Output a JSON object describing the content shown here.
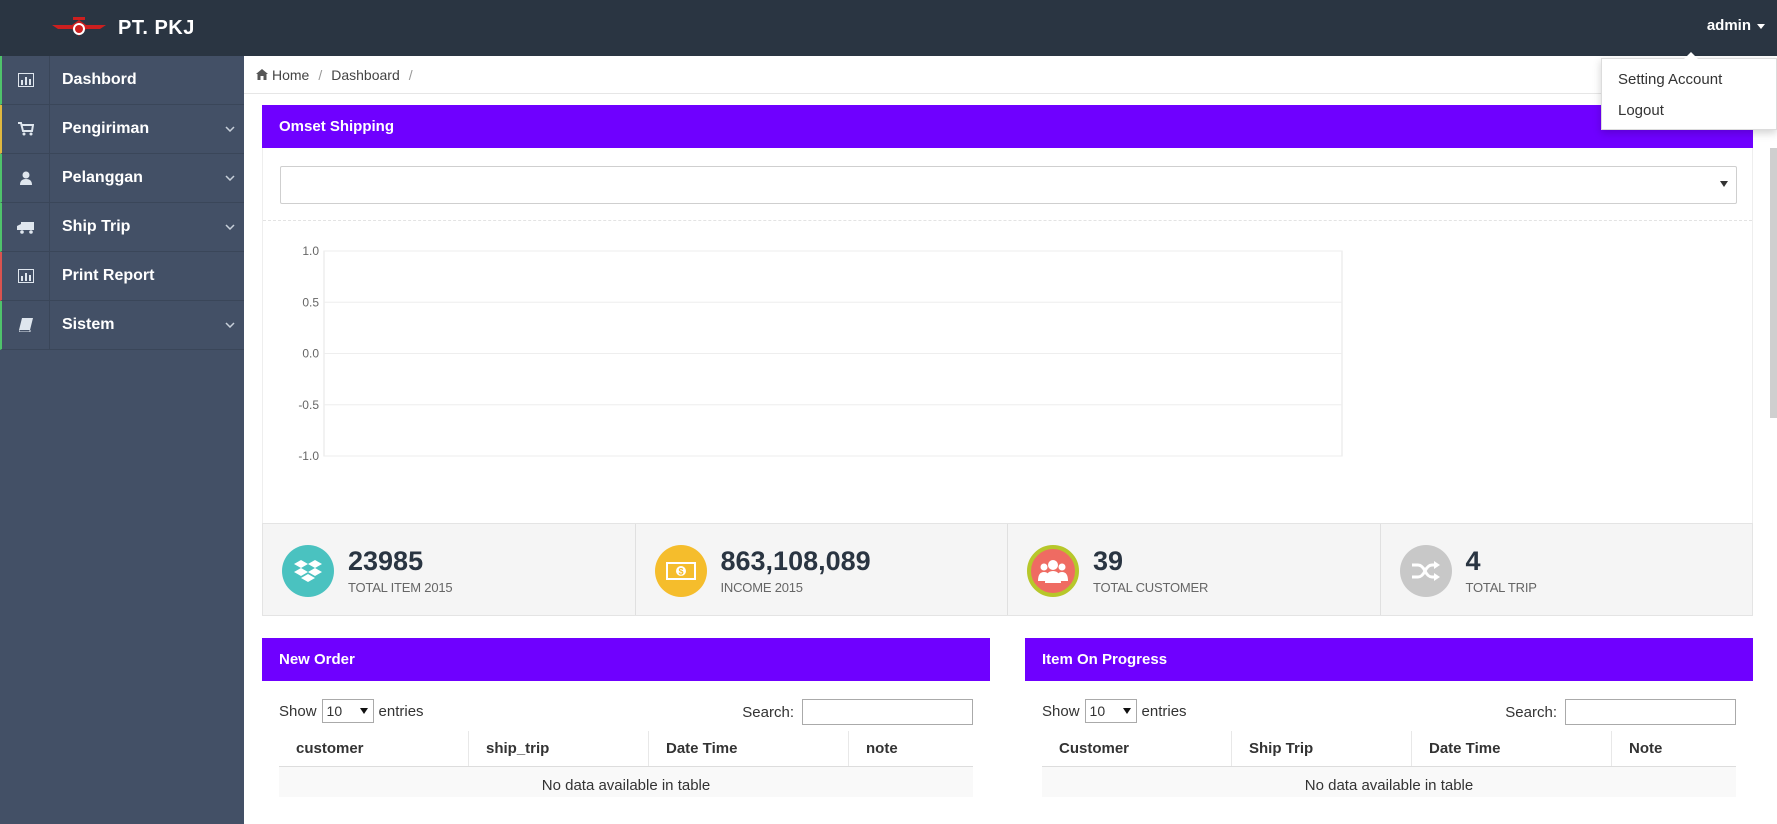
{
  "topbar": {
    "brand": "PT. PKJ",
    "user": "admin"
  },
  "user_dropdown": {
    "items": [
      "Setting Account",
      "Logout"
    ]
  },
  "sidebar": {
    "items": [
      {
        "label": "Dashbord",
        "icon": "bar-chart-icon",
        "has_submenu": false
      },
      {
        "label": "Pengiriman",
        "icon": "cart-icon",
        "has_submenu": true
      },
      {
        "label": "Pelanggan",
        "icon": "user-icon",
        "has_submenu": true
      },
      {
        "label": "Ship Trip",
        "icon": "truck-icon",
        "has_submenu": true
      },
      {
        "label": "Print Report",
        "icon": "bar-chart-icon",
        "has_submenu": false
      },
      {
        "label": "Sistem",
        "icon": "book-icon",
        "has_submenu": true
      }
    ]
  },
  "breadcrumb": {
    "home": "Home",
    "current": "Dashboard",
    "sep": "/"
  },
  "omset": {
    "title": "Omset Shipping",
    "select_value": ""
  },
  "chart_data": {
    "type": "line",
    "title": "",
    "xlabel": "",
    "ylabel": "",
    "ylim": [
      -1.0,
      1.0
    ],
    "yticks": [
      "1.0",
      "0.5",
      "0.0",
      "-0.5",
      "-1.0"
    ],
    "series": [],
    "grid": true
  },
  "stats": [
    {
      "value": "23985",
      "label": "TOTAL ITEM 2015",
      "icon": "dropbox-icon",
      "color": "#4ac2c0"
    },
    {
      "value": "863,108,089",
      "label": "INCOME 2015",
      "icon": "money-icon",
      "color": "#f5bd2c"
    },
    {
      "value": "39",
      "label": "TOTAL CUSTOMER",
      "icon": "users-icon",
      "color": "#ef6b62"
    },
    {
      "value": "4",
      "label": "TOTAL TRIP",
      "icon": "shuffle-icon",
      "color": "#c8c8c8"
    }
  ],
  "new_order": {
    "title": "New Order",
    "show": "Show",
    "entries_value": "10",
    "entries": "entries",
    "search": "Search:",
    "columns": [
      "customer",
      "ship_trip",
      "Date Time",
      "note"
    ],
    "empty": "No data available in table"
  },
  "item_progress": {
    "title": "Item On Progress",
    "show": "Show",
    "entries_value": "10",
    "entries": "entries",
    "search": "Search:",
    "columns": [
      "Customer",
      "Ship Trip",
      "Date Time",
      "Note"
    ],
    "empty": "No data available in table"
  }
}
